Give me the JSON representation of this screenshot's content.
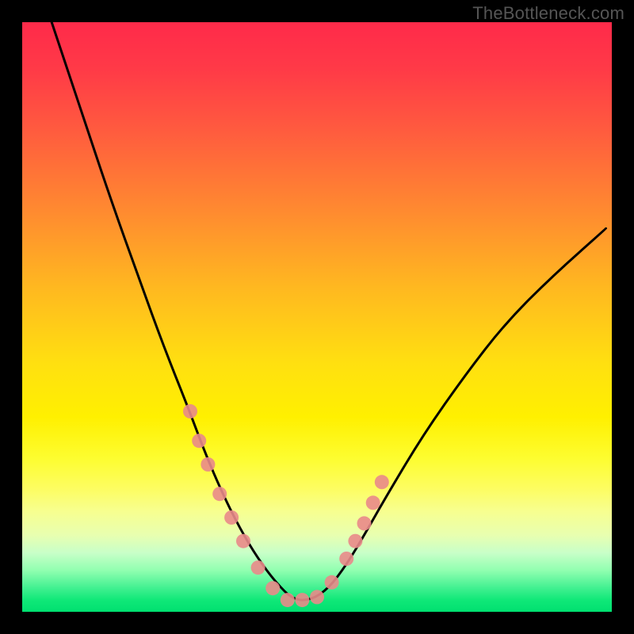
{
  "watermark": "TheBottleneck.com",
  "chart_data": {
    "type": "line",
    "title": "",
    "xlabel": "",
    "ylabel": "",
    "xlim": [
      0,
      100
    ],
    "ylim": [
      0,
      100
    ],
    "description": "V-shaped bottleneck curve on a vertical rainbow gradient (red=top/high bottleneck, green=bottom/low). Minimum sits near x≈46 at y≈2.",
    "series": [
      {
        "name": "bottleneck-curve",
        "x": [
          5,
          10,
          15,
          20,
          24,
          28,
          31,
          34,
          37,
          40,
          43,
          46,
          49,
          52,
          55,
          58,
          62,
          68,
          75,
          82,
          90,
          99
        ],
        "y": [
          100,
          85,
          70,
          56,
          45,
          35,
          27,
          20,
          14,
          9,
          5,
          2,
          2,
          4,
          8,
          13,
          20,
          30,
          40,
          49,
          57,
          65
        ]
      }
    ],
    "markers": {
      "name": "highlight-dots",
      "color": "#e98a8a",
      "x": [
        28.5,
        30.0,
        31.5,
        33.5,
        35.5,
        37.5,
        40.0,
        42.5,
        45.0,
        47.5,
        50.0,
        52.5,
        55.0,
        56.5,
        58.0,
        59.5,
        61.0
      ],
      "y": [
        34.0,
        29.0,
        25.0,
        20.0,
        16.0,
        12.0,
        7.5,
        4.0,
        2.0,
        2.0,
        2.5,
        5.0,
        9.0,
        12.0,
        15.0,
        18.5,
        22.0
      ]
    }
  }
}
